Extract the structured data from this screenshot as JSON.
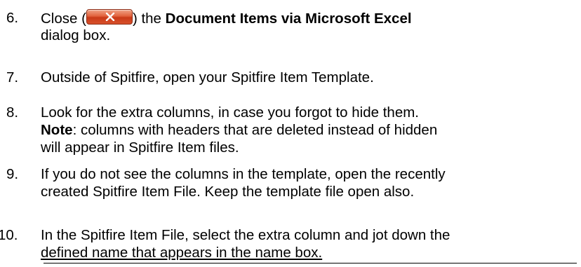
{
  "steps": [
    {
      "number": "6.",
      "before_button": "Close (",
      "after_button": ") the ",
      "bold": "Document Items via Microsoft Excel",
      "line2": "dialog box."
    },
    {
      "number": "7.",
      "text": "Outside of Spitfire, open your Spitfire Item Template."
    },
    {
      "number": "8.",
      "text": "Look for the extra columns, in case you forgot to hide them.",
      "note_label": "Note",
      "note_text": ": columns with headers that are deleted instead of hidden",
      "line3": "will appear in Spitfire Item files."
    },
    {
      "number": "9.",
      "text": "If you do not see the columns in the template, open the recently",
      "line2": "created Spitfire Item File.  Keep the template file open also."
    },
    {
      "number": "10.",
      "text": "In the Spitfire Item File, select the extra column and jot down the",
      "line2": "defined name that appears in the name box."
    }
  ],
  "close_button": {
    "icon": "close-x-icon",
    "color": "#d94f2b"
  },
  "colors": {
    "text": "#000000",
    "background": "#ffffff"
  }
}
